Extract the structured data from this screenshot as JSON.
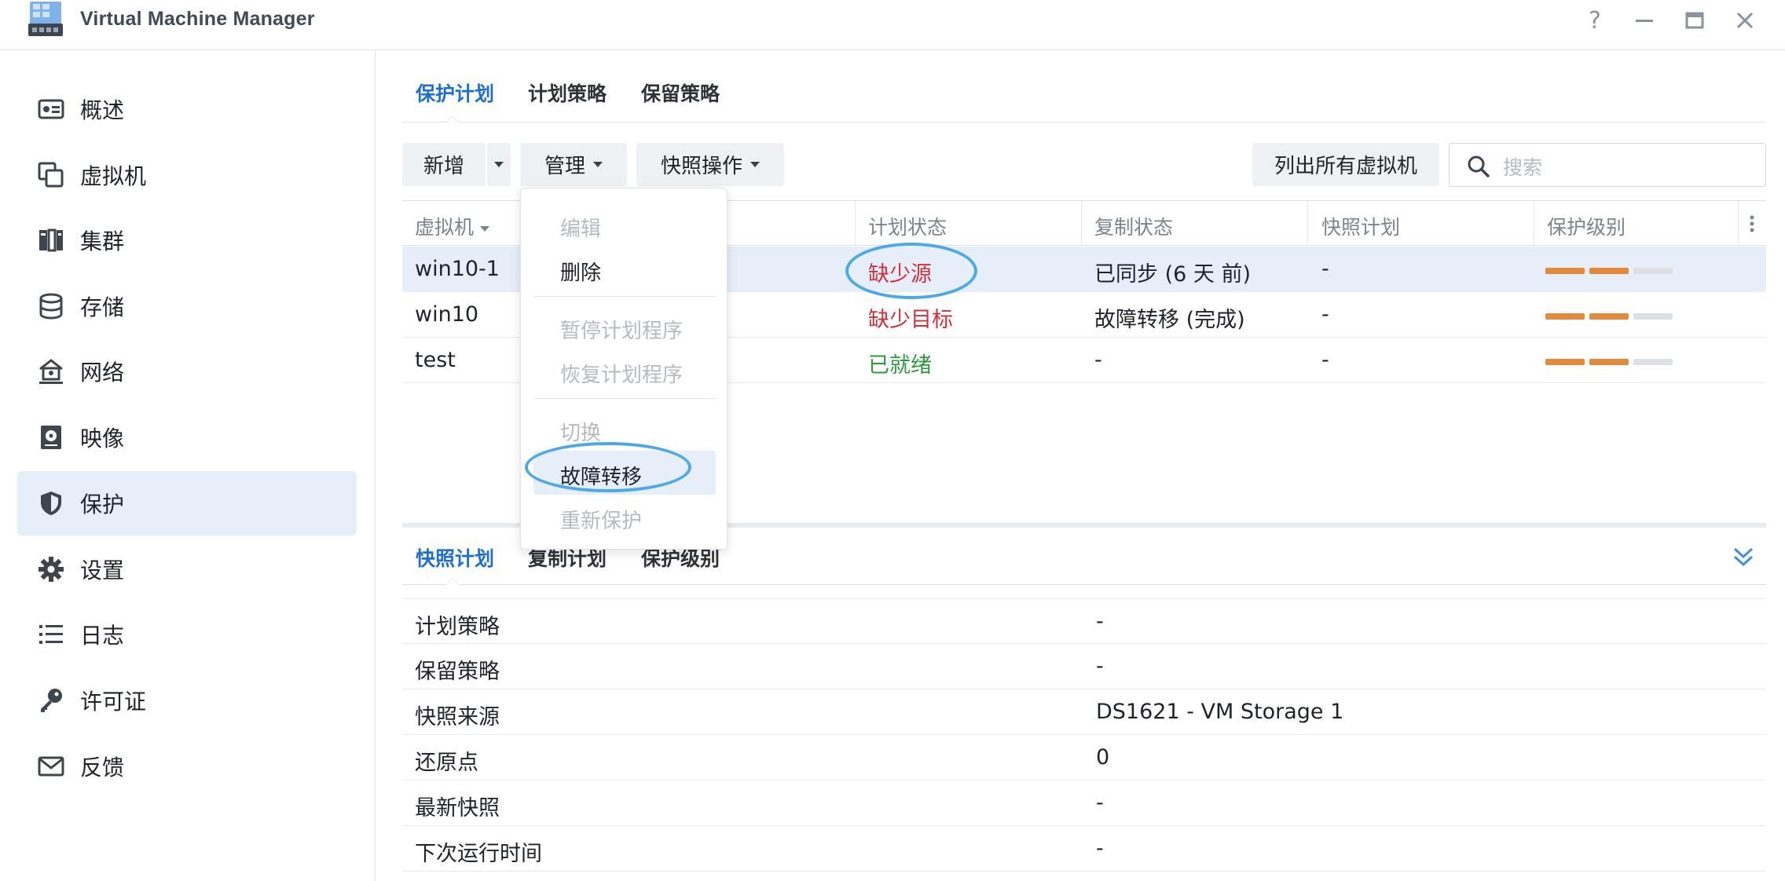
{
  "app": {
    "title": "Virtual Machine Manager"
  },
  "window_controls": {
    "help": "?",
    "minimize": "—",
    "maximize": "▭",
    "close": "✕"
  },
  "sidebar": {
    "items": [
      {
        "label": "概述",
        "icon": "overview-icon"
      },
      {
        "label": "虚拟机",
        "icon": "virtual-machine-icon"
      },
      {
        "label": "集群",
        "icon": "cluster-icon"
      },
      {
        "label": "存储",
        "icon": "storage-icon"
      },
      {
        "label": "网络",
        "icon": "network-icon"
      },
      {
        "label": "映像",
        "icon": "image-icon"
      },
      {
        "label": "保护",
        "icon": "shield-icon",
        "active": true
      },
      {
        "label": "设置",
        "icon": "gear-icon"
      },
      {
        "label": "日志",
        "icon": "log-list-icon"
      },
      {
        "label": "许可证",
        "icon": "key-icon"
      },
      {
        "label": "反馈",
        "icon": "mail-icon"
      }
    ]
  },
  "tabs": [
    {
      "label": "保护计划",
      "active": true
    },
    {
      "label": "计划策略"
    },
    {
      "label": "保留策略"
    }
  ],
  "toolbar": {
    "add": "新增",
    "manage": "管理",
    "snapshot_ops": "快照操作",
    "list_all_vms": "列出所有虚拟机",
    "search_placeholder": "搜索"
  },
  "table": {
    "columns": [
      "虚拟机",
      "计划状态",
      "复制状态",
      "快照计划",
      "保护级别"
    ],
    "rows": [
      {
        "vm": "win10-1",
        "plan_status": "缺少源",
        "replication": "已同步 (6 天 前)",
        "snapshot_plan": "-",
        "protection_level": 2,
        "selected": true
      },
      {
        "vm": "win10",
        "plan_status": "缺少目标",
        "replication": "故障转移 (完成)",
        "snapshot_plan": "-",
        "protection_level": 2
      },
      {
        "vm": "test",
        "plan_status": "已就绪",
        "replication": "-",
        "snapshot_plan": "-",
        "protection_level": 2
      }
    ],
    "protection_level_max": 3
  },
  "manage_menu": {
    "items": [
      {
        "label": "编辑",
        "enabled": false
      },
      {
        "label": "删除",
        "enabled": true
      },
      {
        "label": "暂停计划程序",
        "enabled": false
      },
      {
        "label": "恢复计划程序",
        "enabled": false
      },
      {
        "label": "切换",
        "enabled": false
      },
      {
        "label": "故障转移",
        "enabled": true,
        "highlighted": true
      },
      {
        "label": "重新保护",
        "enabled": false
      }
    ]
  },
  "details": {
    "tabs": [
      {
        "label": "快照计划",
        "active": true
      },
      {
        "label": "复制计划"
      },
      {
        "label": "保护级别"
      }
    ],
    "rows": [
      {
        "label": "计划策略",
        "value": "-"
      },
      {
        "label": "保留策略",
        "value": "-"
      },
      {
        "label": "快照来源",
        "value": "DS1621 - VM Storage 1"
      },
      {
        "label": "还原点",
        "value": "0"
      },
      {
        "label": "最新快照",
        "value": "-"
      },
      {
        "label": "下次运行时间",
        "value": "-"
      }
    ]
  },
  "colors": {
    "accent": "#1f6fd1",
    "error": "#d1303a",
    "ok": "#2c9a3c",
    "level_filled": "#e5883a",
    "level_empty": "#dcdfe3",
    "annotation": "#4aa9e6"
  }
}
